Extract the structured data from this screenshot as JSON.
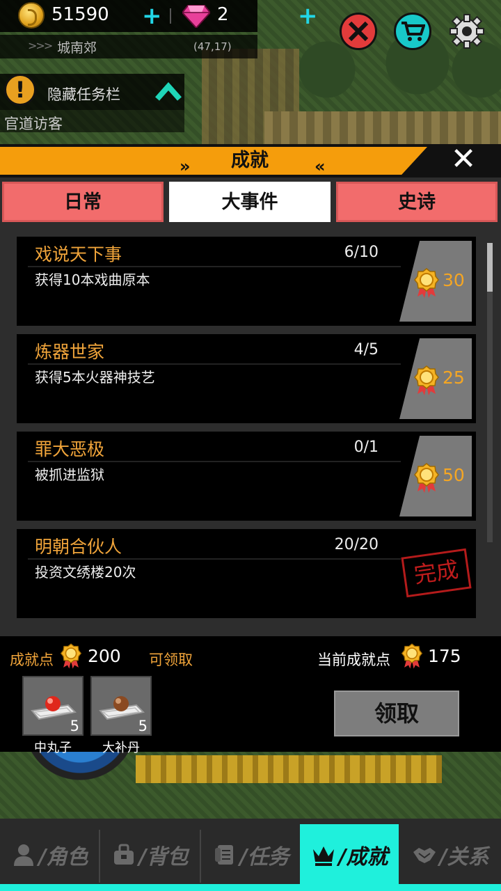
{
  "topbar": {
    "gold": "51590",
    "gems": "2",
    "plus_symbol": "+"
  },
  "location": {
    "arrows": ">>>",
    "name": "城南郊",
    "coords": "(47,17)"
  },
  "quest": {
    "warn_symbol": "!",
    "hide_label": "隐藏任务栏",
    "current": "官道访客"
  },
  "panel": {
    "title": "成就",
    "deco_left": "»",
    "deco_right": "«",
    "close_symbol": "✕",
    "tabs": [
      {
        "label": "日常",
        "active": false
      },
      {
        "label": "大事件",
        "active": true
      },
      {
        "label": "史诗",
        "active": false
      }
    ],
    "achievements": [
      {
        "title": "戏说天下事",
        "progress": "6/10",
        "desc": "获得10本戏曲原本",
        "reward": "30"
      },
      {
        "title": "炼器世家",
        "progress": "4/5",
        "desc": "获得5本火器神技艺",
        "reward": "25"
      },
      {
        "title": "罪大恶极",
        "progress": "0/1",
        "desc": "被抓进监狱",
        "reward": "50"
      },
      {
        "title": "明朝合伙人",
        "progress": "20/20",
        "desc": "投资文绣楼20次",
        "status": "完成"
      }
    ]
  },
  "bottom": {
    "points_label": "成就点",
    "points_value": "200",
    "claimable_label": "可领取",
    "current_label": "当前成就点",
    "current_value": "175",
    "items": [
      {
        "name": "中丸子",
        "count": "5",
        "icon": "red-pill-icon"
      },
      {
        "name": "大补丹",
        "count": "5",
        "icon": "brown-pill-icon"
      }
    ],
    "claim_label": "领取"
  },
  "nav": {
    "items": [
      {
        "label": "/角色",
        "icon": "person-icon",
        "active": false
      },
      {
        "label": "/背包",
        "icon": "bag-icon",
        "active": false
      },
      {
        "label": "/任务",
        "icon": "scroll-icon",
        "active": false
      },
      {
        "label": "/成就",
        "icon": "crown-icon",
        "active": true
      },
      {
        "label": "/关系",
        "icon": "handshake-icon",
        "active": false
      }
    ]
  },
  "colors": {
    "accent_orange": "#f59d0c",
    "tab_red": "#f26c6c",
    "nav_active": "#1ff0dc",
    "text_orange": "#f0a43a"
  }
}
